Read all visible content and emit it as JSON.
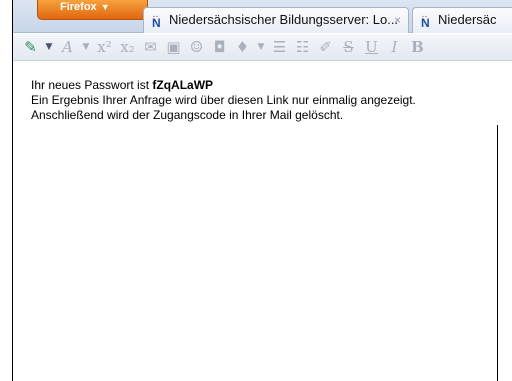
{
  "browser": {
    "menu_label": "Firefox",
    "tabs": [
      {
        "title": "Niedersächsischer Bildungsserver: Lo...",
        "close": "×"
      },
      {
        "title": "Niedersäc"
      }
    ]
  },
  "toolbar": {
    "buttons": [
      "tag",
      "dropdown",
      "font-style",
      "dropdown",
      "superscript",
      "subscript",
      "email",
      "image",
      "smiley",
      "embed",
      "paint",
      "dropdown",
      "bullet-list",
      "numbered-list",
      "brush",
      "strikethrough",
      "underline",
      "italic",
      "bold"
    ]
  },
  "message": {
    "line1_prefix": "Ihr neues Passwort ist ",
    "password": "fZqALaWP",
    "line2": "Ein Ergebnis Ihrer Anfrage wird über diesen Link nur einmalig angezeigt.",
    "line3": "Anschließend wird der Zugangscode in Ihrer Mail gelöscht."
  }
}
